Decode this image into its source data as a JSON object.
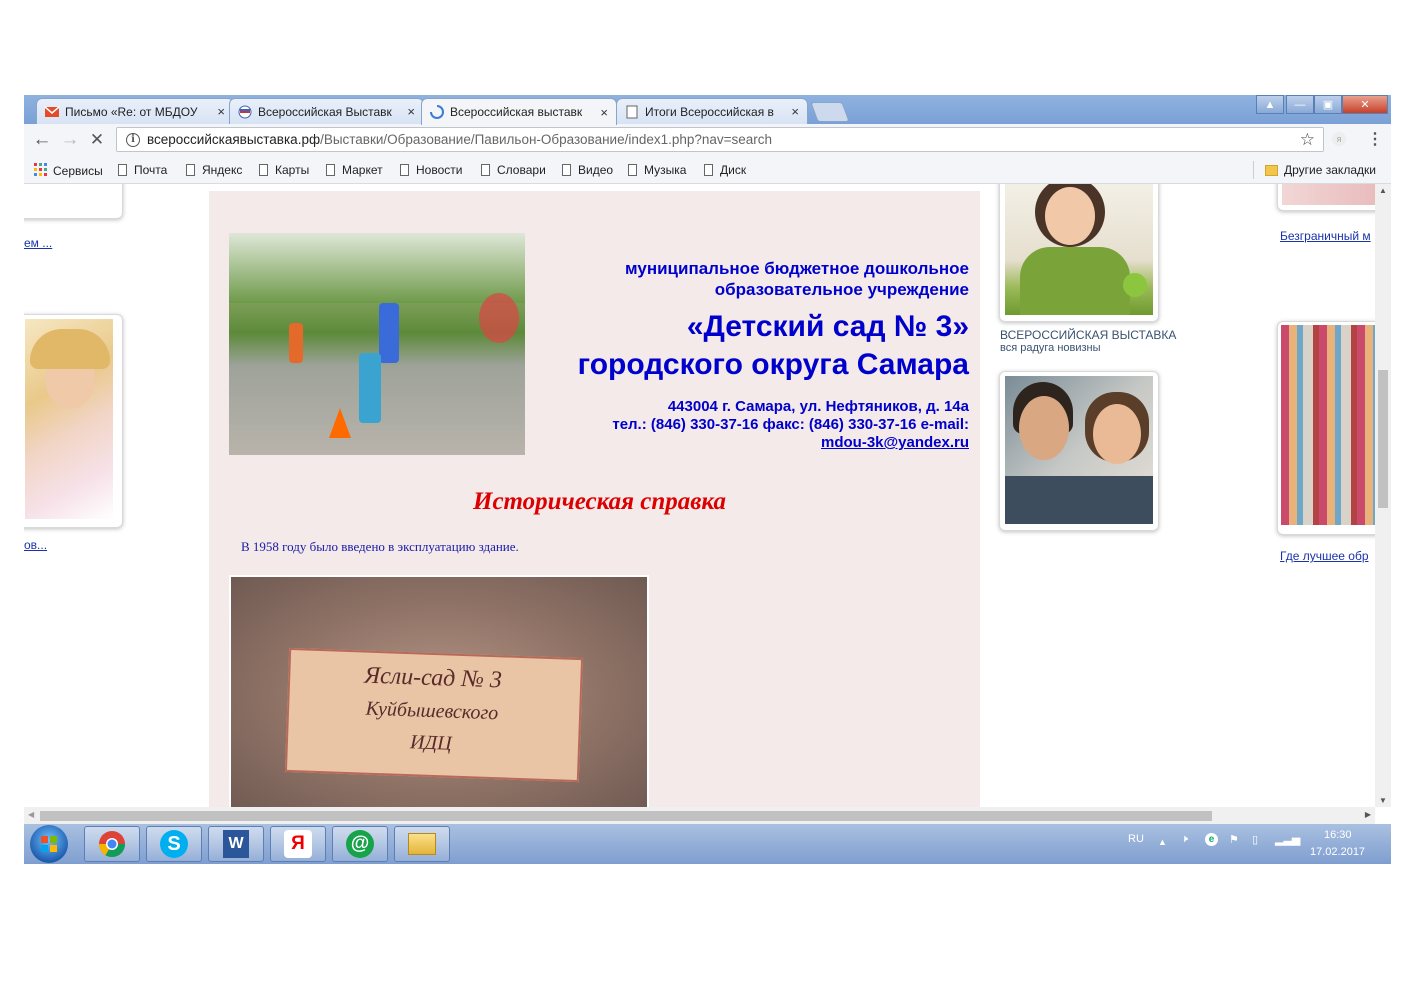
{
  "browser": {
    "tabs": [
      {
        "label": "Письмо «Re: от МБДОУ",
        "close": "×",
        "active": false
      },
      {
        "label": "Всероссийская Выставк",
        "close": "×",
        "active": false
      },
      {
        "label": "Всероссийская выставк",
        "close": "×",
        "active": true
      },
      {
        "label": "Итоги Всероссийская в",
        "close": "×",
        "active": false
      }
    ],
    "window_buttons": {
      "profile": "▲",
      "minimize": "—",
      "maximize": "▣",
      "close": "✕"
    },
    "nav": {
      "back": "←",
      "forward": "→",
      "stop": "✕"
    },
    "address": {
      "host": "всероссийскаявыставка.рф",
      "path": "/Выставки/Образование/Павильон-Образование/index1.php?nav=search"
    },
    "bookmarks": {
      "apps_label": "Сервисы",
      "items": [
        "Почта",
        "Яндекс",
        "Карты",
        "Маркет",
        "Новости",
        "Словари",
        "Видео",
        "Музыка",
        "Диск"
      ],
      "other_label": "Другие закладки"
    }
  },
  "page": {
    "institution_line1": "муниципальное бюджетное дошкольное",
    "institution_line2": "образовательное учреждение",
    "name_line1": "«Детский сад № 3»",
    "name_line2": "городского округа Самара",
    "address": "443004 г. Самара, ул. Нефтяников, д. 14а",
    "phones": "тел.: (846) 330-37-16 факс: (846) 330-37-16 e-mail:",
    "email": "mdou-3k@yandex.ru",
    "section_title": "Историческая справка",
    "paragraph": "В 1958 году было введено в эксплуатацию здание.",
    "plaque_line1": "Ясли-сад № 3",
    "plaque_line2": "Куйбышевского",
    "plaque_line3": "ИДЦ",
    "left_link_top": "ем ...",
    "left_link_bottom": "ов...",
    "right_caption_title": "ВСЕРОССИЙСКАЯ ВЫСТАВКА",
    "right_caption_sub": "вся радуга новизны",
    "far_right_link_top": "Безграничный м",
    "far_right_link_bottom": "Где лучшее обр"
  },
  "taskbar": {
    "lang": "RU",
    "time": "16:30",
    "date": "17.02.2017",
    "skype_letter": "S",
    "word_letter": "W",
    "yandex_letter": "Я",
    "agent_letter": "@"
  },
  "colors": {
    "accent_blue": "#0000cc",
    "section_red": "#dd0000",
    "panel_bg": "#f4eaea",
    "taskbar": "#8aa6d4"
  }
}
